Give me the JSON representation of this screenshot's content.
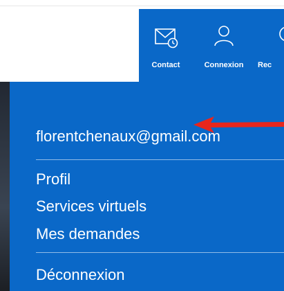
{
  "header": {
    "nav": [
      {
        "label": "Contact",
        "icon": "contact-mail-clock-icon"
      },
      {
        "label": "Connexion",
        "icon": "user-icon"
      },
      {
        "label": "Rec",
        "icon": "search-icon"
      }
    ]
  },
  "account_menu": {
    "email": "florentchenaux@gmail.com",
    "items": [
      {
        "label": "Profil"
      },
      {
        "label": "Services virtuels"
      },
      {
        "label": "Mes demandes"
      }
    ],
    "logout_label": "Déconnexion"
  },
  "colors": {
    "brand_blue": "#0a68c8",
    "annotation_arrow": "#e8261c"
  }
}
